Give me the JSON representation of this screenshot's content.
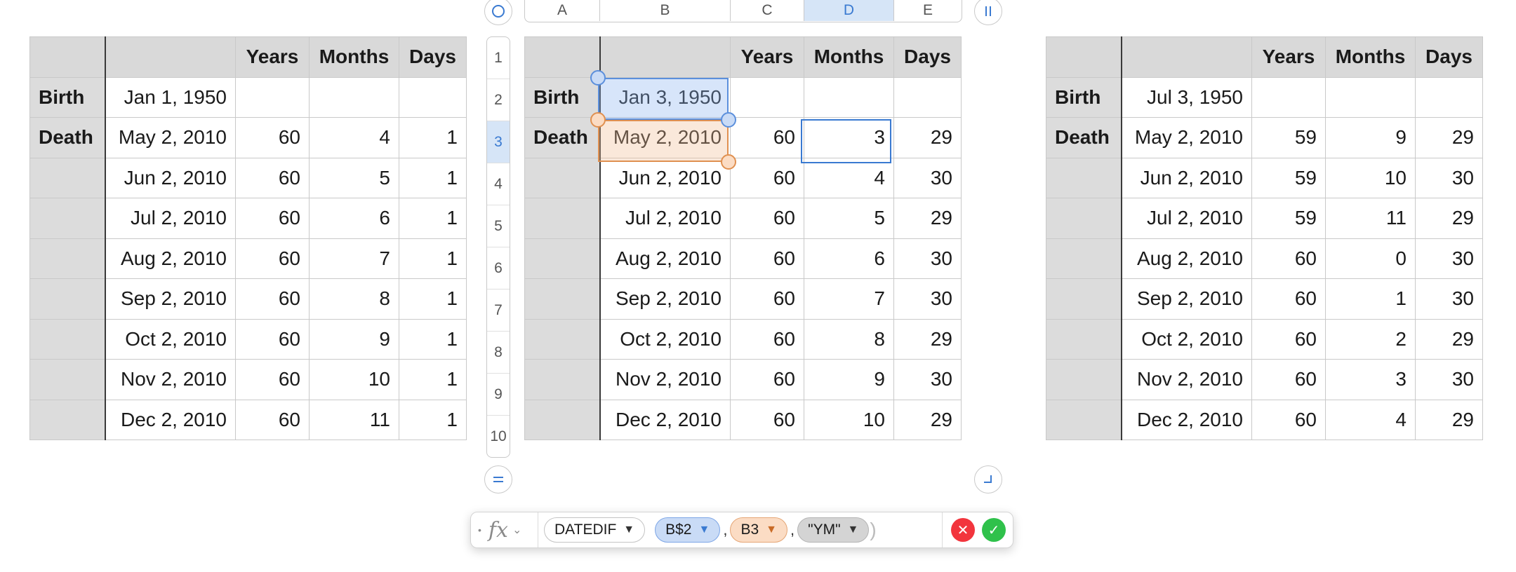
{
  "headers": {
    "years": "Years",
    "months": "Months",
    "days": "Days"
  },
  "row_labels": {
    "birth": "Birth",
    "death": "Death"
  },
  "column_letters": [
    "A",
    "B",
    "C",
    "D",
    "E"
  ],
  "row_numbers": [
    "1",
    "2",
    "3",
    "4",
    "5",
    "6",
    "7",
    "8",
    "9",
    "10"
  ],
  "table1": {
    "birth_date": "Jan 1, 1950",
    "rows": [
      {
        "date": "May 2, 2010",
        "years": "60",
        "months": "4",
        "days": "1"
      },
      {
        "date": "Jun 2, 2010",
        "years": "60",
        "months": "5",
        "days": "1"
      },
      {
        "date": "Jul 2, 2010",
        "years": "60",
        "months": "6",
        "days": "1"
      },
      {
        "date": "Aug 2, 2010",
        "years": "60",
        "months": "7",
        "days": "1"
      },
      {
        "date": "Sep 2, 2010",
        "years": "60",
        "months": "8",
        "days": "1"
      },
      {
        "date": "Oct 2, 2010",
        "years": "60",
        "months": "9",
        "days": "1"
      },
      {
        "date": "Nov 2, 2010",
        "years": "60",
        "months": "10",
        "days": "1"
      },
      {
        "date": "Dec 2, 2010",
        "years": "60",
        "months": "11",
        "days": "1"
      }
    ]
  },
  "table2": {
    "birth_date": "Jan 3, 1950",
    "rows": [
      {
        "date": "May 2, 2010",
        "years": "60",
        "months": "3",
        "days": "29"
      },
      {
        "date": "Jun 2, 2010",
        "years": "60",
        "months": "4",
        "days": "30"
      },
      {
        "date": "Jul 2, 2010",
        "years": "60",
        "months": "5",
        "days": "29"
      },
      {
        "date": "Aug 2, 2010",
        "years": "60",
        "months": "6",
        "days": "30"
      },
      {
        "date": "Sep 2, 2010",
        "years": "60",
        "months": "7",
        "days": "30"
      },
      {
        "date": "Oct 2, 2010",
        "years": "60",
        "months": "8",
        "days": "29"
      },
      {
        "date": "Nov 2, 2010",
        "years": "60",
        "months": "9",
        "days": "30"
      },
      {
        "date": "Dec 2, 2010",
        "years": "60",
        "months": "10",
        "days": "29"
      }
    ]
  },
  "table3": {
    "birth_date": "Jul 3, 1950",
    "rows": [
      {
        "date": "May 2, 2010",
        "years": "59",
        "months": "9",
        "days": "29"
      },
      {
        "date": "Jun 2, 2010",
        "years": "59",
        "months": "10",
        "days": "30"
      },
      {
        "date": "Jul 2, 2010",
        "years": "59",
        "months": "11",
        "days": "29"
      },
      {
        "date": "Aug 2, 2010",
        "years": "60",
        "months": "0",
        "days": "30"
      },
      {
        "date": "Sep 2, 2010",
        "years": "60",
        "months": "1",
        "days": "30"
      },
      {
        "date": "Oct 2, 2010",
        "years": "60",
        "months": "2",
        "days": "29"
      },
      {
        "date": "Nov 2, 2010",
        "years": "60",
        "months": "3",
        "days": "30"
      },
      {
        "date": "Dec 2, 2010",
        "years": "60",
        "months": "4",
        "days": "29"
      }
    ]
  },
  "formula": {
    "function_name": "DATEDIF",
    "arg1": "B$2",
    "arg2": "B3",
    "arg3": "\"YM\"",
    "separator": ","
  },
  "icons": {
    "fx": "fx",
    "cancel": "✕",
    "accept": "✓",
    "caret": "▼",
    "chevron": "⌄"
  },
  "colors": {
    "ref_blue": "#5b8fdc",
    "ref_orange": "#e09050",
    "cancel_red": "#f2353d",
    "accept_green": "#2fc14b"
  }
}
